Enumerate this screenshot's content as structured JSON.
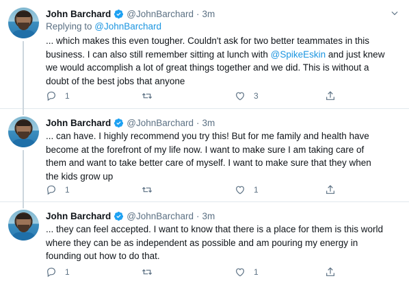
{
  "tweets": [
    {
      "name": "John Barchard",
      "handle": "@JohnBarchard",
      "dot": "·",
      "time": "3m",
      "replying_prefix": "Replying to ",
      "replying_to": "@JohnBarchard",
      "text_lines": [
        "... which makes this even tougher. Couldn't ask for two better teammates in this",
        "business. I can also still remember sitting at lunch with ",
        "@SpikeEskin",
        " and just knew",
        "we would accomplish a lot of great things together and we did. This is without a",
        "doubt of the best jobs that anyone"
      ],
      "reply_count": "1",
      "retweet_count": "",
      "like_count": "3"
    },
    {
      "name": "John Barchard",
      "handle": "@JohnBarchard",
      "dot": "·",
      "time": "3m",
      "text_lines": [
        "... can have. I highly recommend you try this! But for me family and health have",
        "become at the forefront of my life now. I want to make sure I am taking care of",
        "them and want to take better care of myself. I want to make sure that they when",
        "the kids grow up"
      ],
      "reply_count": "1",
      "retweet_count": "",
      "like_count": "1"
    },
    {
      "name": "John Barchard",
      "handle": "@JohnBarchard",
      "dot": "·",
      "time": "3m",
      "text_lines": [
        "... they can feel accepted. I want to know that there is a place for them is this world",
        "where they can be as independent  as possible and am pouring my energy in",
        "founding out how to do that."
      ],
      "reply_count": "1",
      "retweet_count": "",
      "like_count": "1"
    }
  ],
  "icons": {
    "verified": "verified-badge-icon",
    "caret": "chevron-down-icon",
    "reply": "reply-icon",
    "retweet": "retweet-icon",
    "like": "heart-icon",
    "share": "share-icon"
  },
  "colors": {
    "link": "#1b95e0",
    "secondary_text": "#5b7083",
    "verified": "#1da1f2",
    "divider": "#e1e8ed"
  }
}
